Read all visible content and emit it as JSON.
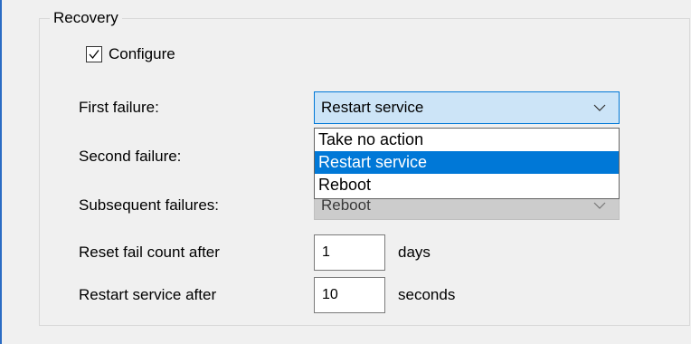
{
  "recovery": {
    "group_title": "Recovery",
    "configure": {
      "label": "Configure",
      "checked": true
    },
    "first_failure": {
      "label": "First failure:",
      "value": "Restart service"
    },
    "second_failure": {
      "label": "Second failure:"
    },
    "subsequent_failures": {
      "label": "Subsequent failures:",
      "value": "Reboot"
    },
    "dropdown_options": [
      "Take no action",
      "Restart service",
      "Reboot"
    ],
    "dropdown_selected": "Restart service",
    "reset_fail_count": {
      "label": "Reset fail count after",
      "value": "1",
      "unit": "days"
    },
    "restart_service": {
      "label": "Restart service after",
      "value": "10",
      "unit": "seconds"
    }
  },
  "icons": {
    "checkbox": "checkmark-icon",
    "combo_arrow": "chevron-down-icon"
  },
  "colors": {
    "focus_border": "#0078d7",
    "focus_fill": "#cce4f7",
    "selection": "#0078d7",
    "disabled_fill": "#cccccc"
  }
}
